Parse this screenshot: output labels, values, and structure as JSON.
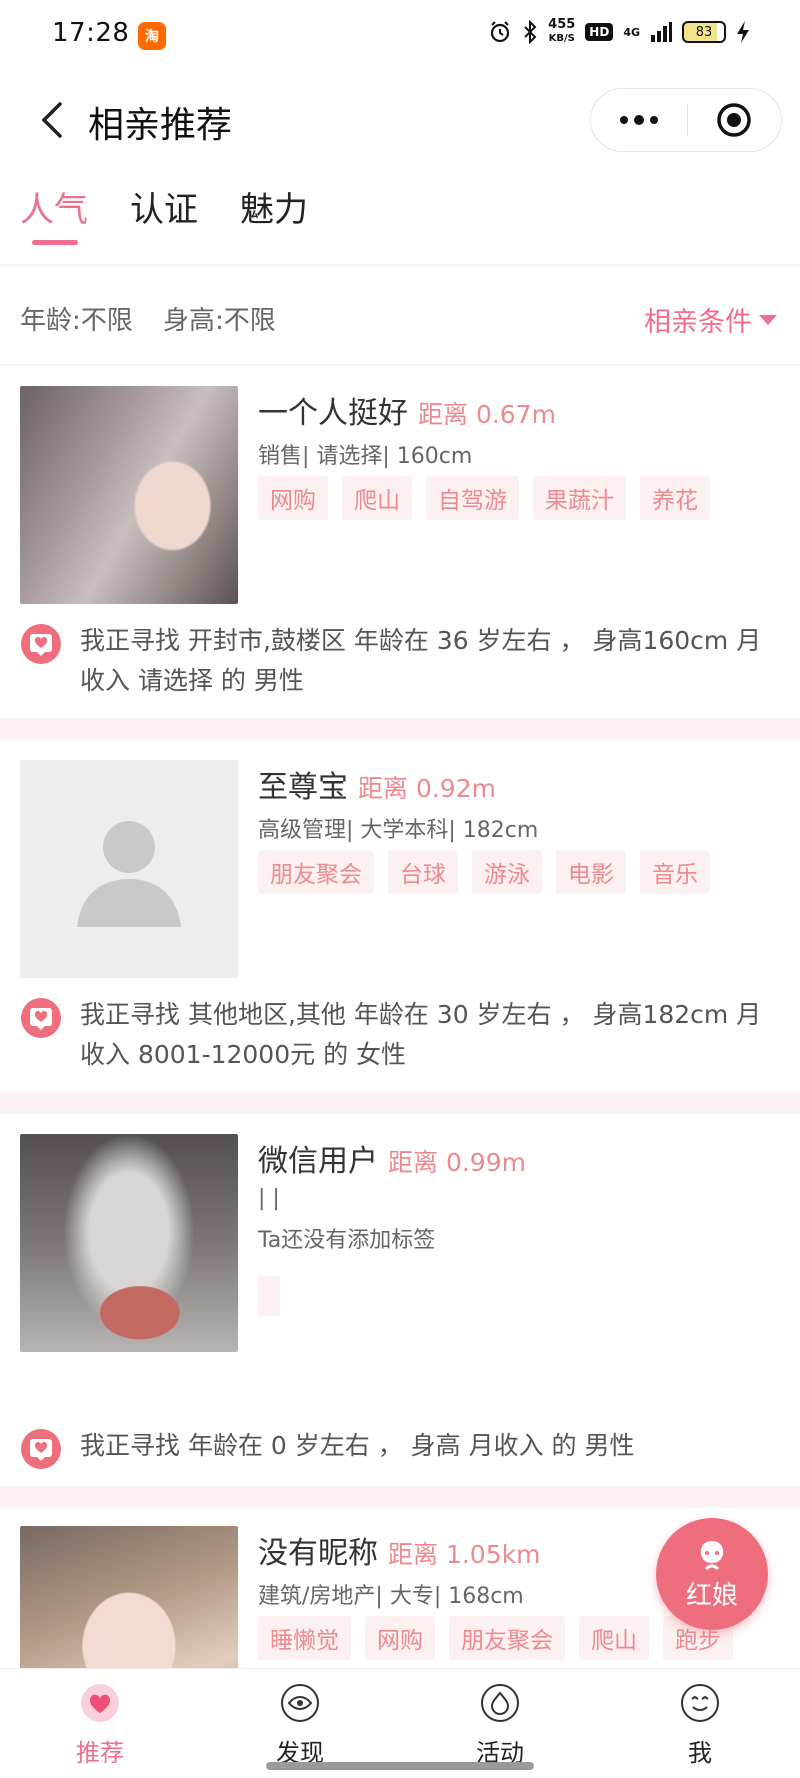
{
  "status_bar": {
    "time": "17:28",
    "app_icon": "淘",
    "net_speed_value": "455",
    "net_speed_unit": "KB/S",
    "hd": "HD",
    "network": "4G",
    "battery": "83"
  },
  "header": {
    "title": "相亲推荐"
  },
  "tabs": [
    {
      "label": "人气",
      "active": true
    },
    {
      "label": "认证",
      "active": false
    },
    {
      "label": "魅力",
      "active": false
    }
  ],
  "filter": {
    "age": "年龄:不限",
    "height": "身高:不限",
    "conditions_label": "相亲条件"
  },
  "profiles": [
    {
      "name": "一个人挺好",
      "distance": "距离 0.67m",
      "info": "销售| 请选择| 160cm",
      "tags": [
        "网购",
        "爬山",
        "自驾游",
        "果蔬汁",
        "养花"
      ],
      "seeking": "我正寻找 开封市,鼓楼区 年龄在 36 岁左右 ， 身高160cm 月收入 请选择 的 男性"
    },
    {
      "name": "至尊宝",
      "distance": "距离 0.92m",
      "info": "高级管理| 大学本科| 182cm",
      "tags": [
        "朋友聚会",
        "台球",
        "游泳",
        "电影",
        "音乐"
      ],
      "seeking": "我正寻找 其他地区,其他 年龄在 30 岁左右 ， 身高182cm 月收入 8001-12000元 的 女性"
    },
    {
      "name": "微信用户",
      "distance": "距离 0.99m",
      "info": "| |",
      "no_tags": "Ta还没有添加标签",
      "seeking": "我正寻找 年龄在 0 岁左右 ， 身高 月收入 的 男性"
    },
    {
      "name": "没有昵称",
      "distance": "距离 1.05km",
      "info": "建筑/房地产| 大专| 168cm",
      "tags": [
        "睡懒觉",
        "网购",
        "朋友聚会",
        "爬山",
        "跑步"
      ]
    }
  ],
  "floating": {
    "matchmaker_label": "红娘"
  },
  "bottom_nav": [
    {
      "label": "推荐",
      "icon": "heart-icon",
      "active": true
    },
    {
      "label": "发现",
      "icon": "eye-icon",
      "active": false
    },
    {
      "label": "活动",
      "icon": "activity-icon",
      "active": false
    },
    {
      "label": "我",
      "icon": "smiley-icon",
      "active": false
    }
  ],
  "colors": {
    "accent": "#ee6e8b",
    "tag_text": "#ec8a8f",
    "tag_bg": "#fdf0f0",
    "separator": "#fcf1f3"
  }
}
